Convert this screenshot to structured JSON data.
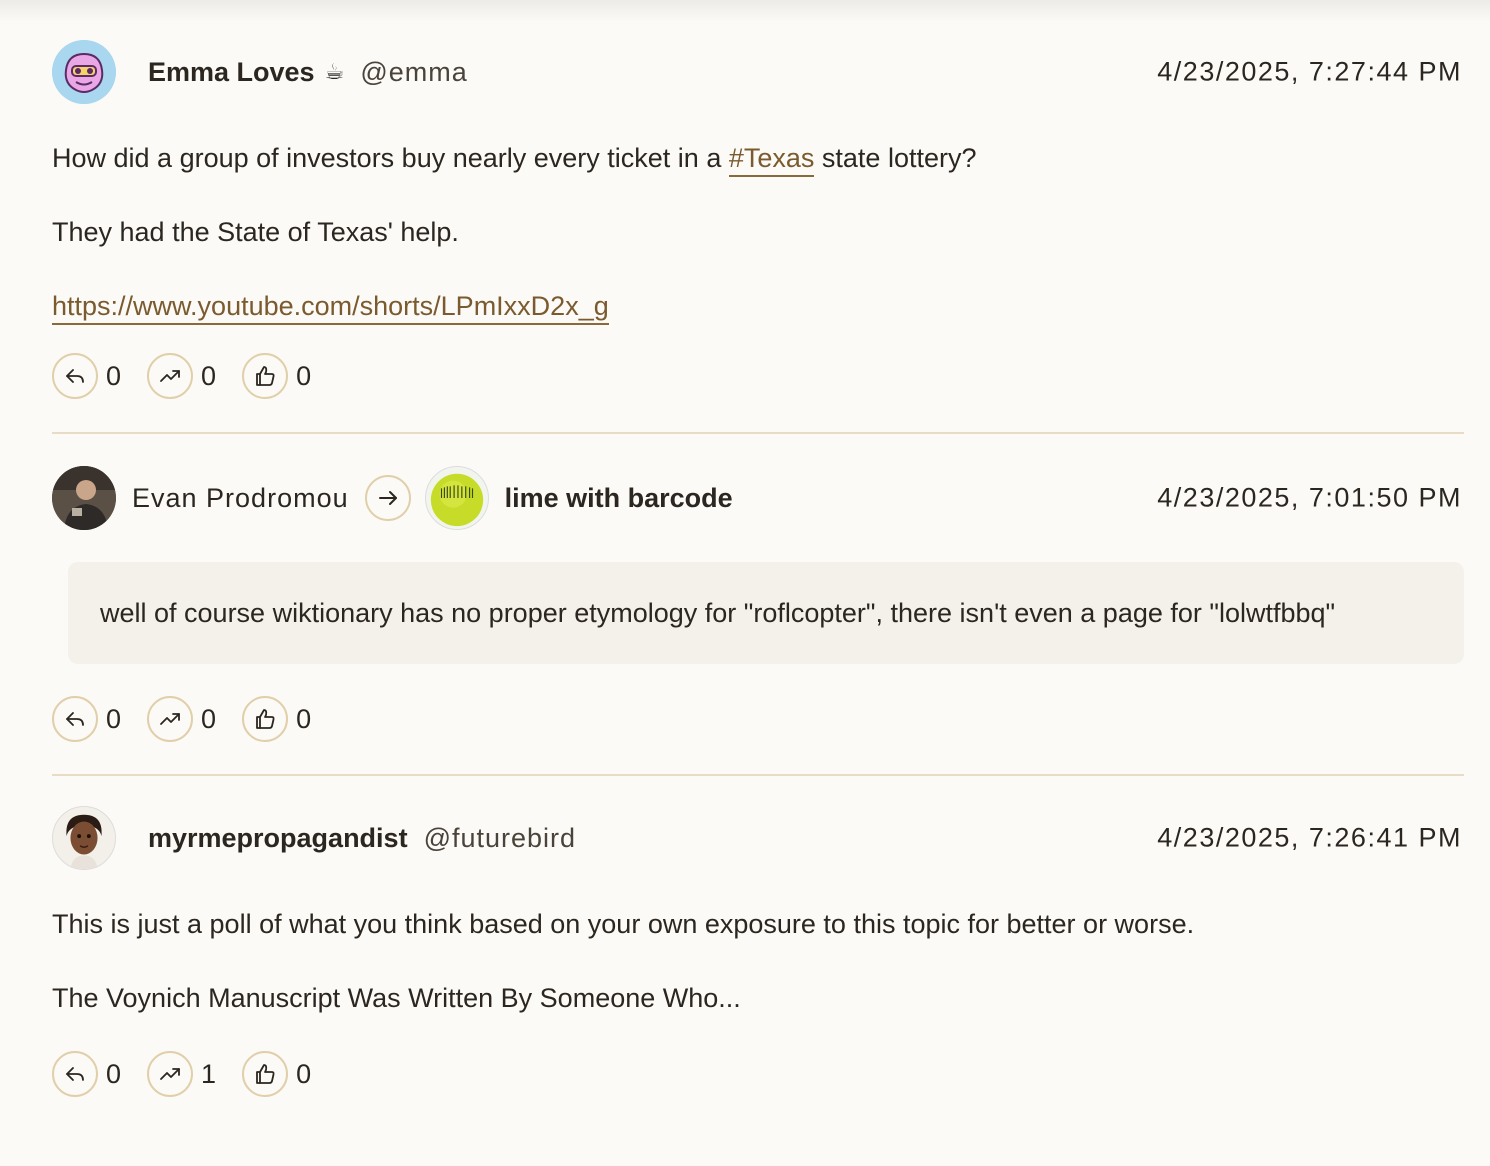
{
  "posts": [
    {
      "display_name": "Emma Loves",
      "name_emoji": "☕",
      "handle": "@emma",
      "timestamp": "4/23/2025, 7:27:44 PM",
      "body": {
        "line1_before": "How did a group of investors buy nearly every ticket in a ",
        "hashtag": "#Texas",
        "line1_after": " state lottery?",
        "line2": "They had the State of Texas' help.",
        "link": "https://www.youtube.com/shorts/LPmIxxD2x_g"
      },
      "counts": {
        "replies": "0",
        "shares": "0",
        "likes": "0"
      }
    },
    {
      "sharer_name": "Evan Prodromou",
      "target_name": "lime with barcode",
      "timestamp": "4/23/2025, 7:01:50 PM",
      "quote_text": "well of course wiktionary has no proper etymology for \"roflcopter\", there isn't even a page for \"lolwtfbbq\"",
      "counts": {
        "replies": "0",
        "shares": "0",
        "likes": "0"
      }
    },
    {
      "display_name": "myrmepropagandist",
      "handle": "@futurebird",
      "timestamp": "4/23/2025, 7:26:41 PM",
      "body": {
        "line1": "This is just a poll of what you think based on your own exposure to this topic for better or worse.",
        "line2": "The Voynich Manuscript Was Written By Someone Who..."
      },
      "counts": {
        "replies": "0",
        "shares": "1",
        "likes": "0"
      }
    }
  ],
  "colors": {
    "background": "#fbfaf6",
    "accent_border": "#e0cfa9",
    "link": "#7a5a2e",
    "divider": "#e8dcc6",
    "quote_bg": "#f4f1ea"
  },
  "icons": {
    "reply": "reply-icon",
    "share": "trending-up-icon",
    "like": "thumbs-up-icon",
    "forward": "arrow-right-icon"
  }
}
